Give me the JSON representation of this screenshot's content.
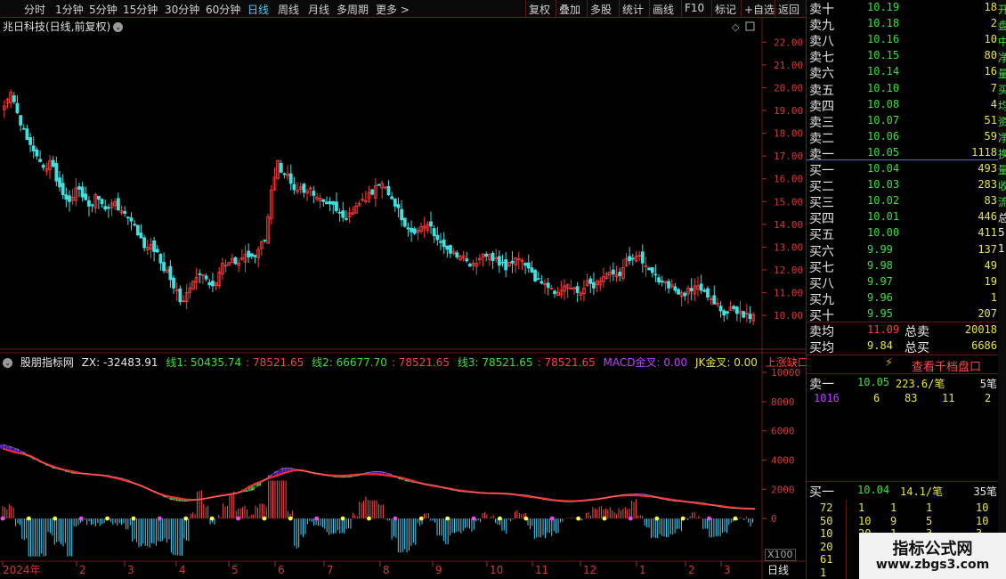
{
  "toolbar": {
    "periods": [
      "分时",
      "1分钟",
      "5分钟",
      "15分钟",
      "30分钟",
      "60分钟",
      "日线",
      "周线",
      "月线",
      "多周期",
      "更多 >"
    ],
    "active_period": "日线",
    "actions": [
      "复权",
      "叠加",
      "多股",
      "统计",
      "画线",
      "F10",
      "标记",
      "+自选",
      "返回"
    ]
  },
  "stock": {
    "title": "兆日科技(日线,前复权)"
  },
  "price_axis": [
    "22.00",
    "21.00",
    "20.00",
    "19.00",
    "18.00",
    "17.00",
    "16.00",
    "15.00",
    "14.00",
    "13.00",
    "12.00",
    "11.00",
    "10.00"
  ],
  "indicator_axis": [
    "10000",
    "8000",
    "6000",
    "4000",
    "2000",
    "0"
  ],
  "date_axis": [
    "2024年",
    "2",
    "3",
    "4",
    "5",
    "6",
    "7",
    "8",
    "9",
    "10",
    "11",
    "12",
    "1",
    "2",
    "3"
  ],
  "indicator": {
    "name": "股朋指标网",
    "zx": "ZX: -32483.91",
    "x1": "线1: 50435.74",
    "x1b": ": 78521.65",
    "x2": "线2: 66677.70",
    "x2b": ": 78521.65",
    "x3": "线3: 78521.65",
    "x3b": ": 78521.65",
    "macd": "MACD金叉: 0.00",
    "jk": "JK金叉: 0.00",
    "gap": "上涨缺口: 0.00"
  },
  "x100": "X100",
  "period_footer": "日线",
  "orderbook": {
    "sell": [
      {
        "label": "卖十",
        "price": "10.19",
        "vol": "18"
      },
      {
        "label": "卖九",
        "price": "10.18",
        "vol": "2"
      },
      {
        "label": "卖八",
        "price": "10.16",
        "vol": "10"
      },
      {
        "label": "卖七",
        "price": "10.15",
        "vol": "80"
      },
      {
        "label": "卖六",
        "price": "10.14",
        "vol": "16"
      },
      {
        "label": "卖五",
        "price": "10.10",
        "vol": "7"
      },
      {
        "label": "卖四",
        "price": "10.08",
        "vol": "4"
      },
      {
        "label": "卖三",
        "price": "10.07",
        "vol": "51"
      },
      {
        "label": "卖二",
        "price": "10.06",
        "vol": "59"
      },
      {
        "label": "卖一",
        "price": "10.05",
        "vol": "1118"
      }
    ],
    "buy": [
      {
        "label": "买一",
        "price": "10.04",
        "vol": "493"
      },
      {
        "label": "买二",
        "price": "10.03",
        "vol": "283"
      },
      {
        "label": "买三",
        "price": "10.02",
        "vol": "83"
      },
      {
        "label": "买四",
        "price": "10.01",
        "vol": "446"
      },
      {
        "label": "买五",
        "price": "10.00",
        "vol": "411"
      },
      {
        "label": "买六",
        "price": "9.99",
        "vol": "137"
      },
      {
        "label": "买七",
        "price": "9.98",
        "vol": "49"
      },
      {
        "label": "买八",
        "price": "9.97",
        "vol": "19"
      },
      {
        "label": "买九",
        "price": "9.96",
        "vol": "1"
      },
      {
        "label": "买十",
        "price": "9.95",
        "vol": "207"
      }
    ],
    "avg_sell_label": "卖均",
    "avg_sell": "11.09",
    "total_sell_label": "总卖",
    "total_sell": "20018",
    "avg_buy_label": "买均",
    "avg_buy": "9.84",
    "total_buy_label": "总买",
    "total_buy": "6686"
  },
  "qianbang": {
    "label": "查看千档盘口"
  },
  "sell1_detail": {
    "label": "卖一",
    "price": "10.05",
    "avg": "223.6/笔",
    "count": "5笔",
    "queue": [
      "1016",
      "6",
      "83",
      "11",
      "2"
    ]
  },
  "buy1_detail": {
    "label": "买一",
    "price": "10.04",
    "avg": "14.1/笔",
    "count": "35笔"
  },
  "buy_queue": [
    [
      "72",
      "1",
      "1",
      "1",
      "10"
    ],
    [
      "50",
      "10",
      "9",
      "5",
      "10"
    ],
    [
      "10",
      "20",
      "1",
      "3",
      "3"
    ],
    [
      "20",
      "1",
      "1",
      "1",
      "1"
    ],
    [
      "61",
      "",
      "",
      "",
      ""
    ],
    [
      "1",
      "",
      "",
      "",
      ""
    ]
  ],
  "edge_text": [
    "开",
    "盘",
    "中",
    "净",
    "量",
    "买",
    "均",
    "资",
    "净",
    "换",
    "量",
    "收",
    "流",
    "总",
    "5",
    "1"
  ],
  "watermark": {
    "line1": "指标公式网",
    "line2": "www.zbgs3.com"
  },
  "colors": {
    "up": "#ff3c3c",
    "down": "#3fe0e0",
    "bg": "#000000",
    "grid": "#6a1a1a"
  },
  "chart_data": {
    "type": "candlestick",
    "price_ylim": [
      9.3,
      22.6
    ],
    "indicator_ylim": [
      -2800,
      10800
    ],
    "closes": [
      19.2,
      19.8,
      18.9,
      18.2,
      17.5,
      17.0,
      16.5,
      16.8,
      15.9,
      15.3,
      15.0,
      15.6,
      15.2,
      14.8,
      15.3,
      14.9,
      14.7,
      15.0,
      14.6,
      14.3,
      14.0,
      13.4,
      13.0,
      12.8,
      12.3,
      12.0,
      11.2,
      10.6,
      11.0,
      11.5,
      11.8,
      11.6,
      11.3,
      11.9,
      12.2,
      12.5,
      12.3,
      12.7,
      12.6,
      12.9,
      13.3,
      15.5,
      16.8,
      16.2,
      15.8,
      15.5,
      15.4,
      15.6,
      15.2,
      15.0,
      14.9,
      14.6,
      14.3,
      14.5,
      14.8,
      15.1,
      15.4,
      15.7,
      15.8,
      15.3,
      14.8,
      14.2,
      13.8,
      13.6,
      13.9,
      14.0,
      13.5,
      13.2,
      12.9,
      12.8,
      12.6,
      12.4,
      12.3,
      12.5,
      12.6,
      12.4,
      12.2,
      12.0,
      12.3,
      12.5,
      12.2,
      11.9,
      11.6,
      11.4,
      11.2,
      11.0,
      11.3,
      11.2,
      11.0,
      11.2,
      11.4,
      11.5,
      11.7,
      11.9,
      11.8,
      12.1,
      12.4,
      12.6,
      12.3,
      12.0,
      11.8,
      11.5,
      11.2,
      11.1,
      11.0,
      11.2,
      11.3,
      11.1,
      10.8,
      10.5,
      10.2,
      10.1,
      10.3,
      10.2,
      10.1,
      10.04
    ]
  }
}
